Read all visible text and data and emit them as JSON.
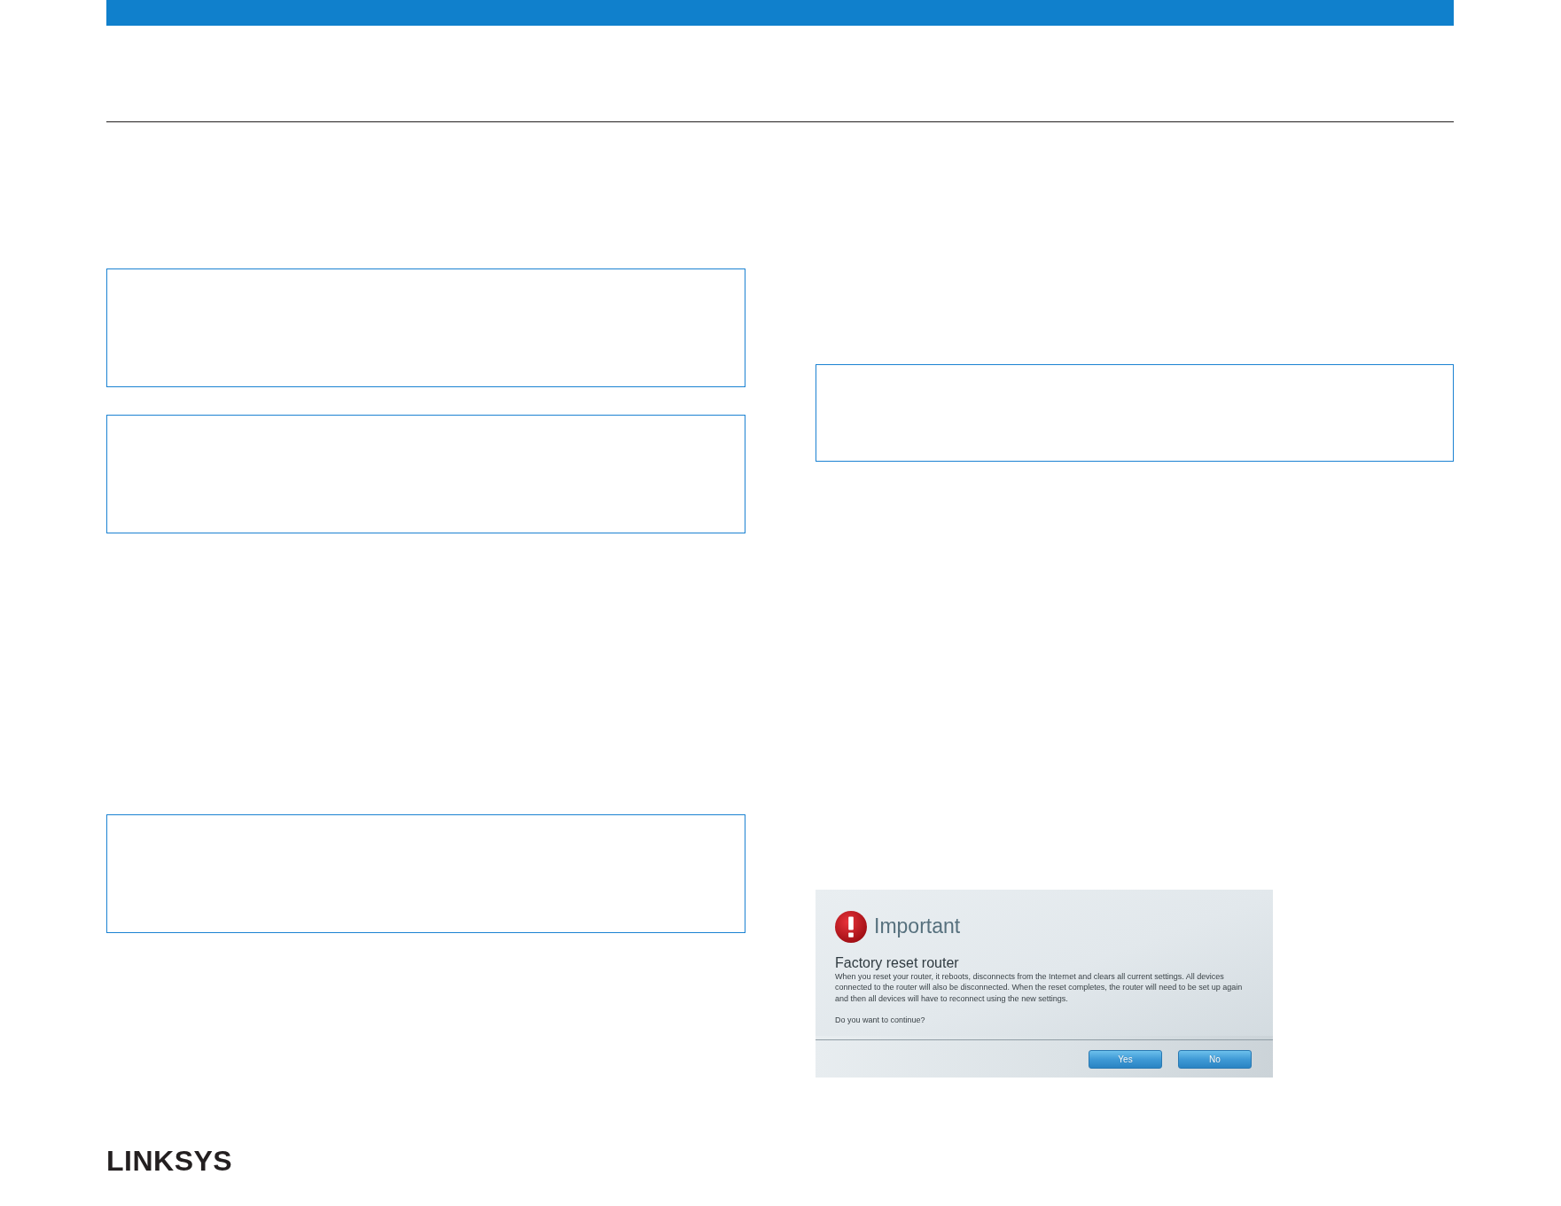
{
  "dialog": {
    "title": "Important",
    "heading": "Factory reset router",
    "message": "When you reset your router, it reboots, disconnects from the Internet and clears all current settings. All devices connected to the router will also be disconnected. When the reset completes, the router will need to be set up again and then all devices will have to reconnect using the new settings.",
    "question": "Do you want to continue?",
    "buttons": [
      "Yes",
      "No"
    ]
  },
  "footer": {
    "logo": "LINKSYS"
  }
}
